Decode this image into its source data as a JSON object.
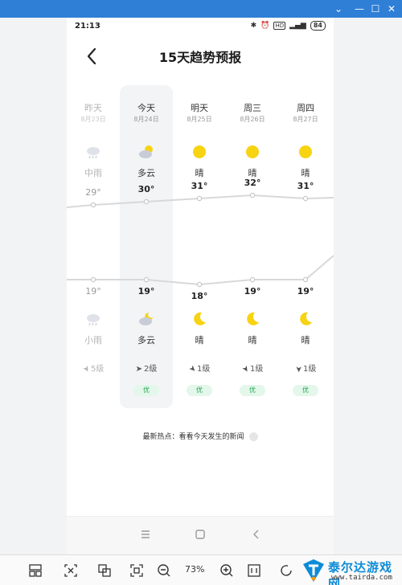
{
  "status_bar": {
    "time": "21:13",
    "battery": "84",
    "badge": "HD"
  },
  "page": {
    "title": "15天趋势预报"
  },
  "days": [
    {
      "label": "昨天",
      "date": "8月23日",
      "day_condition": "中雨",
      "high": "29°",
      "low": "19°",
      "night_condition": "小雨",
      "wind": "5级",
      "aqi": "",
      "day_icon": "rain-cloud-icon",
      "night_icon": "rain-cloud-icon"
    },
    {
      "label": "今天",
      "date": "8月24日",
      "day_condition": "多云",
      "high": "30°",
      "low": "19°",
      "night_condition": "多云",
      "wind": "2级",
      "aqi": "优",
      "day_icon": "partly-cloudy-sun-icon",
      "night_icon": "partly-cloudy-moon-icon"
    },
    {
      "label": "明天",
      "date": "8月25日",
      "day_condition": "晴",
      "high": "31°",
      "low": "18°",
      "night_condition": "晴",
      "wind": "1级",
      "aqi": "优",
      "day_icon": "sun-icon",
      "night_icon": "moon-icon"
    },
    {
      "label": "周三",
      "date": "8月26日",
      "day_condition": "晴",
      "high": "32°",
      "low": "19°",
      "night_condition": "晴",
      "wind": "1级",
      "aqi": "优",
      "day_icon": "sun-icon",
      "night_icon": "moon-icon"
    },
    {
      "label": "周四",
      "date": "8月27日",
      "day_condition": "晴",
      "high": "31°",
      "low": "19°",
      "night_condition": "晴",
      "wind": "1级",
      "aqi": "优",
      "day_icon": "sun-icon",
      "night_icon": "moon-icon"
    }
  ],
  "news": {
    "text": "最新热点：看看今天发生的新闻"
  },
  "viewer": {
    "zoom": "73%"
  },
  "watermark": {
    "name": "泰尔达游戏网",
    "url": "www.tairda.com"
  },
  "colors": {
    "accent": "#2f7fd6",
    "sun": "#f7d312",
    "aqi_green": "#24a455"
  }
}
